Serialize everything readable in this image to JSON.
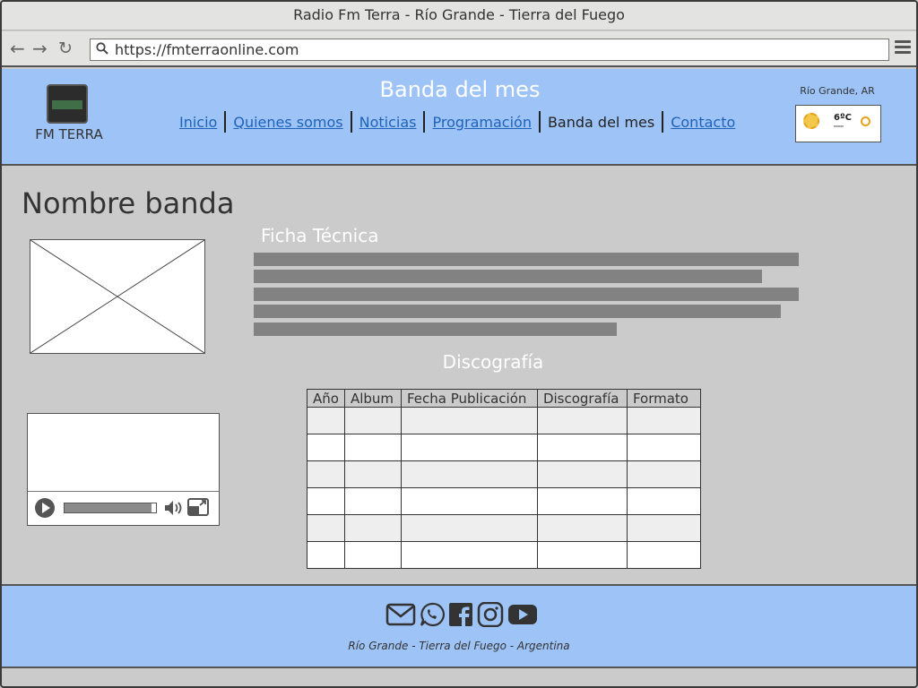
{
  "browser": {
    "title": "Radio Fm Terra - Río Grande - Tierra del Fuego",
    "url": "https://fmterraonline.com"
  },
  "header": {
    "brand": "FM TERRA",
    "page_heading": "Banda del mes",
    "nav": {
      "inicio": "Inicio",
      "quienes": "Quienes somos",
      "noticias": "Noticias",
      "programacion": "Programación",
      "banda": "Banda del mes",
      "contacto": "Contacto"
    },
    "weather": {
      "location": "Río Grande, AR",
      "temperature": "6ºC"
    }
  },
  "main": {
    "band_name": "Nombre banda",
    "ficha_heading": "Ficha Técnica",
    "discografia_heading": "Discografía",
    "video_progress": 0.95,
    "table": {
      "headers": [
        "Año",
        "Album",
        "Fecha Publicación",
        "Discografía",
        "Formato"
      ],
      "row_count": 6
    }
  },
  "footer": {
    "text": "Río Grande - Tierra del Fuego - Argentina"
  },
  "colors": {
    "header_bg": "#9ec3f7",
    "body_bg": "#cbcbcb",
    "link": "#1e63b8"
  }
}
